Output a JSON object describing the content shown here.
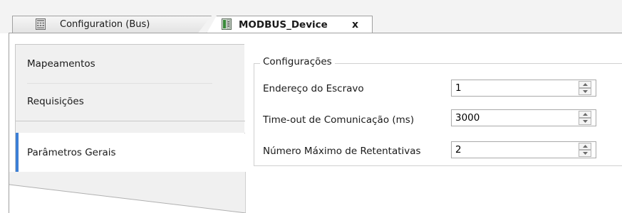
{
  "tabs": [
    {
      "label": "Configuration (Bus)",
      "icon": "bus-config-icon",
      "active": false
    },
    {
      "label": "MODBUS_Device",
      "icon": "device-icon",
      "active": true,
      "close_label": "x"
    }
  ],
  "nav": {
    "items": [
      {
        "label": "Mapeamentos",
        "selected": false
      },
      {
        "label": "Requisições",
        "selected": false
      },
      {
        "label": "Parâmetros Gerais",
        "selected": true
      }
    ],
    "selected_accent": "#3c7fd6"
  },
  "group": {
    "title": "Configurações",
    "fields": [
      {
        "label": "Endereço do Escravo",
        "value": "1"
      },
      {
        "label": "Time-out de Comunicação (ms)",
        "value": "3000"
      },
      {
        "label": "Número Máximo de Retentativas",
        "value": "2"
      }
    ]
  }
}
